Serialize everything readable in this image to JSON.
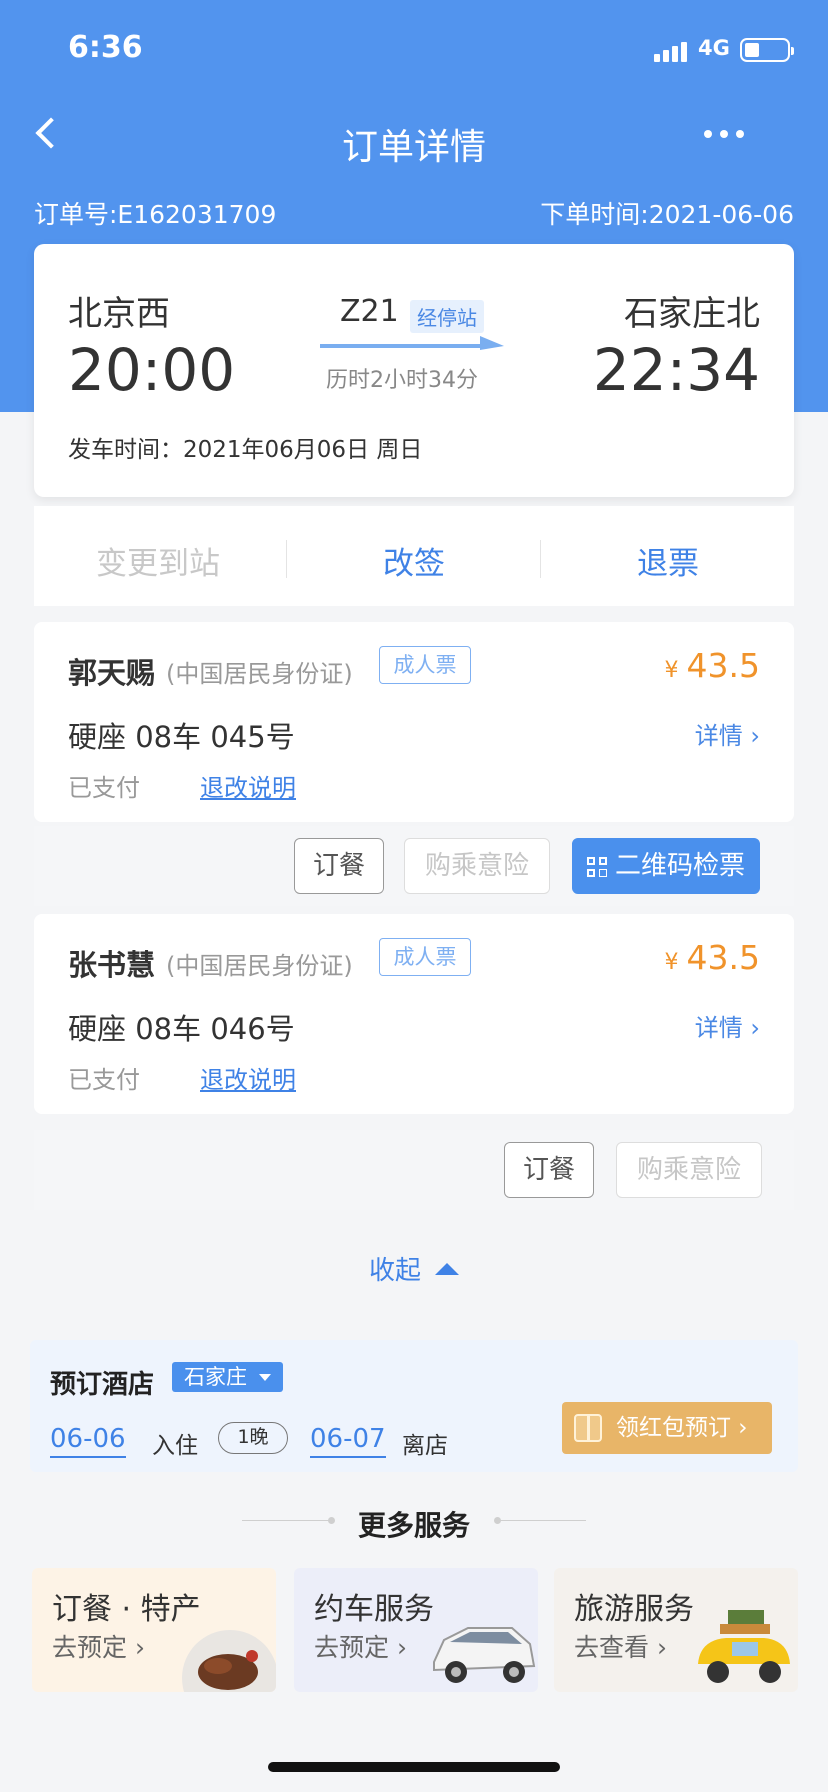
{
  "status_bar": {
    "time": "6:36",
    "network": "4G"
  },
  "header": {
    "title": "订单详情"
  },
  "order": {
    "number_label": "订单号:E162031709",
    "time_label": "下单时间:2021-06-06"
  },
  "trip": {
    "from_station": "北京西",
    "from_time": "20:00",
    "to_station": "石家庄北",
    "to_time": "22:34",
    "train_no": "Z21",
    "stops_link": "经停站",
    "duration": "历时2小时34分",
    "depart_date": "发车时间：2021年06月06日 周日"
  },
  "actions": {
    "change_station": "变更到站",
    "reschedule": "改签",
    "refund": "退票"
  },
  "passengers": [
    {
      "name": "郭天赐",
      "id_type": "(中国居民身份证)",
      "ticket_type": "成人票",
      "currency": "¥",
      "price": "43.5",
      "seat": "硬座  08车  045号",
      "detail": "详情 ›",
      "status": "已支付",
      "rules": "退改说明",
      "btn_meal": "订餐",
      "btn_insurance": "购乘意险",
      "btn_qr": "二维码检票"
    },
    {
      "name": "张书慧",
      "id_type": "(中国居民身份证)",
      "ticket_type": "成人票",
      "currency": "¥",
      "price": "43.5",
      "seat": "硬座  08车  046号",
      "detail": "详情 ›",
      "status": "已支付",
      "rules": "退改说明",
      "btn_meal": "订餐",
      "btn_insurance": "购乘意险"
    }
  ],
  "collapse": "收起",
  "hotel": {
    "title": "预订酒店",
    "city": "石家庄",
    "checkin_date": "06-06",
    "checkin_label": "入住",
    "nights": "1晚",
    "checkout_date": "06-07",
    "checkout_label": "离店",
    "redpack_btn": "领红包预订 ›"
  },
  "services": {
    "title": "更多服务",
    "items": [
      {
        "title": "订餐 · 特产",
        "action": "去预定 ›"
      },
      {
        "title": "约车服务",
        "action": "去预定 ›"
      },
      {
        "title": "旅游服务",
        "action": "去查看 ›"
      }
    ]
  },
  "colors": {
    "brand_blue": "#5294ee",
    "price_orange": "#f0932b",
    "link_blue": "#3f82e6"
  }
}
